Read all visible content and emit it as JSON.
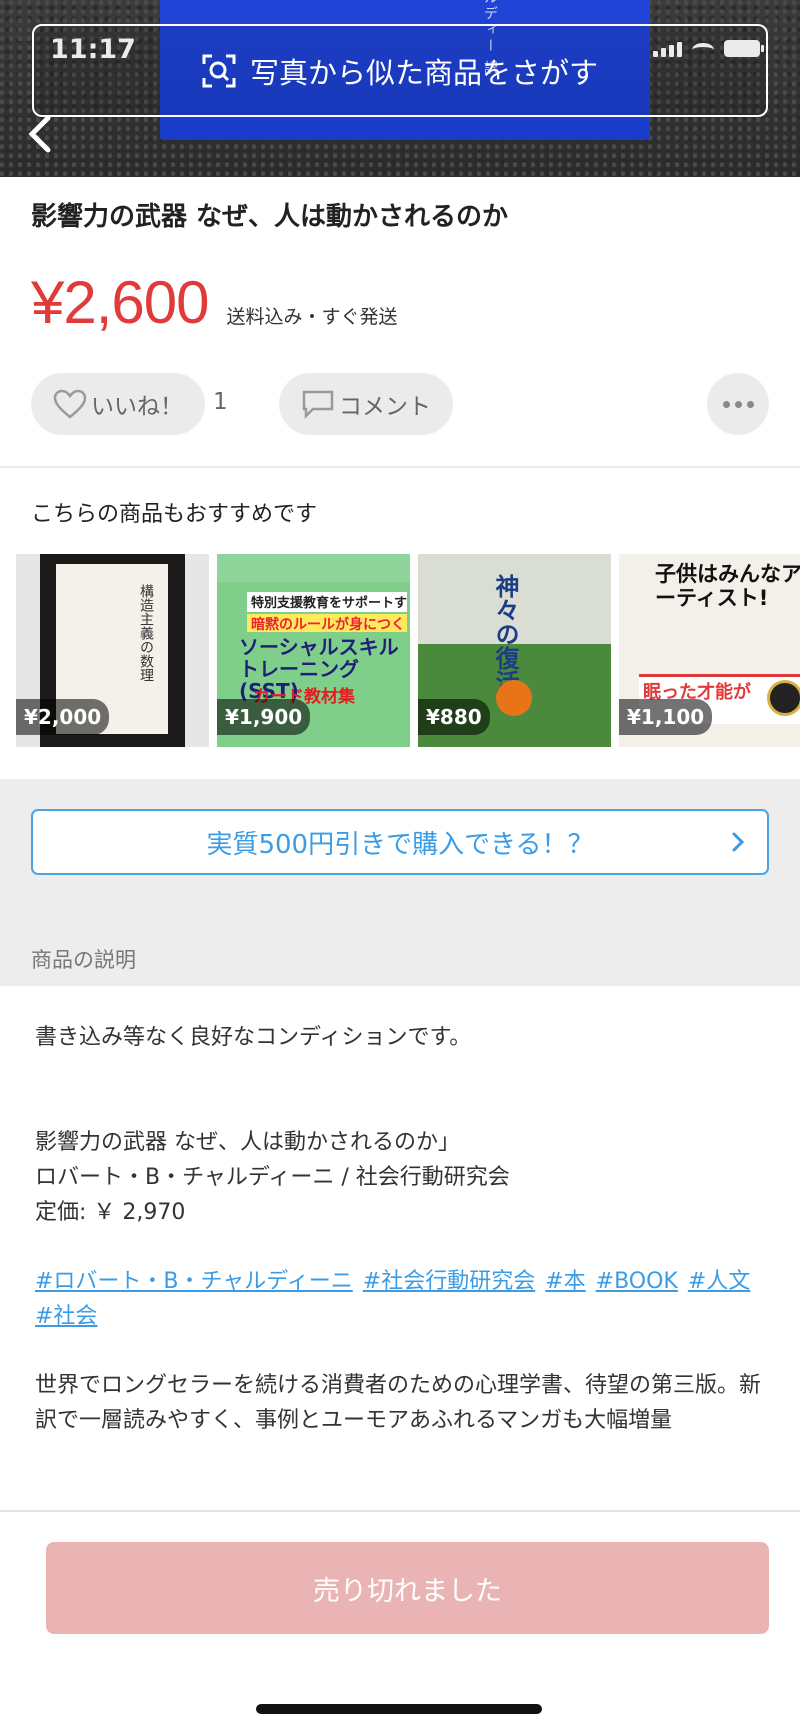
{
  "status": {
    "time": "11:17"
  },
  "hero": {
    "photo_search_label": "写真から似た商品をさがす",
    "cover_text": "ルディー 訳"
  },
  "item": {
    "title": "影響力の武器 なぜ、人は動かされるのか",
    "price": "¥2,600",
    "shipping": "送料込み・すぐ発送"
  },
  "actions": {
    "like_label": "いいね！",
    "like_count": "1",
    "comment_label": "コメント"
  },
  "recommendations": {
    "title": "こちらの商品もおすすめです",
    "items": [
      {
        "price": "¥2,000",
        "cover_text": "構造主義の数理"
      },
      {
        "price": "¥1,900",
        "cover_band1": "特別支援教育をサポートする",
        "cover_band2": "暗黙のルールが身につく",
        "cover_big": "ソーシャルスキルトレーニング(SST)",
        "cover_big2": "カード教材集"
      },
      {
        "price": "¥880",
        "cover_text": "神々の復活"
      },
      {
        "price": "¥1,100",
        "cover_text": "子供はみんなアーティスト!",
        "cover_strip": "眠った才能が"
      }
    ]
  },
  "promo": {
    "label": "実質500円引きで購入できる！？"
  },
  "description": {
    "section_label": "商品の説明",
    "line1": "書き込み等なく良好なコンディションです。",
    "line2": "影響力の武器 なぜ、人は動かされるのか」",
    "line3": "ロバート・B・チャルディーニ / 社会行動研究会",
    "line4": "定価: ￥ 2,970",
    "tags": [
      "#ロバート・B・チャルディーニ",
      "#社会行動研究会",
      "#本",
      "#BOOK",
      "#人文",
      "#社会"
    ],
    "body": "世界でロングセラーを続ける消費者のための心理学書、待望の第三版。新訳で一層読みやすく、事例とユーモアあふれるマンガも大幅増量"
  },
  "footer": {
    "sold_label": "売り切れました"
  },
  "colors": {
    "price": "#e03a3a",
    "link": "#3b9ce5",
    "sold_button": "#ebb4b4"
  }
}
